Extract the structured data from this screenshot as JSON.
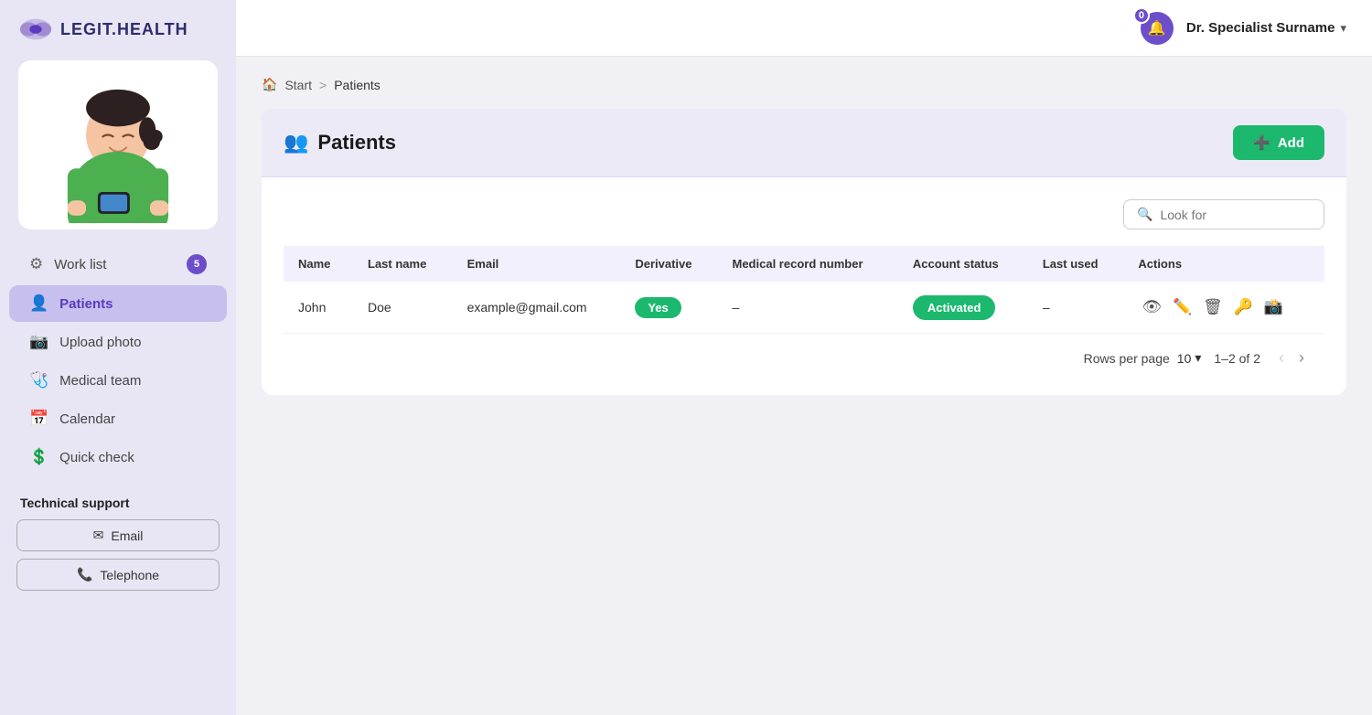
{
  "brand": {
    "name": "LEGIT.HEALTH"
  },
  "header": {
    "notification_count": "0",
    "user_name": "Dr. Specialist Surname"
  },
  "breadcrumb": {
    "home": "Start",
    "separator": ">",
    "current": "Patients"
  },
  "page": {
    "title": "Patients",
    "add_button": "Add"
  },
  "search": {
    "placeholder": "Look for"
  },
  "table": {
    "columns": [
      "Name",
      "Last name",
      "Email",
      "Derivative",
      "Medical record number",
      "Account status",
      "Last used",
      "Actions"
    ],
    "rows": [
      {
        "name": "John",
        "last_name": "Doe",
        "email": "example@gmail.com",
        "derivative": "Yes",
        "medical_record_number": "–",
        "account_status": "Activated",
        "last_used": "–"
      }
    ]
  },
  "pagination": {
    "rows_per_page_label": "Rows per page",
    "rows_per_page_value": "10",
    "info": "1–2 of 2"
  },
  "nav": {
    "items": [
      {
        "id": "work-list",
        "label": "Work list",
        "icon": "⚙",
        "badge": "5",
        "active": false
      },
      {
        "id": "patients",
        "label": "Patients",
        "icon": "👤",
        "badge": "",
        "active": true
      },
      {
        "id": "upload-photo",
        "label": "Upload photo",
        "icon": "📷",
        "badge": "",
        "active": false
      },
      {
        "id": "medical-team",
        "label": "Medical team",
        "icon": "🩺",
        "badge": "",
        "active": false
      },
      {
        "id": "calendar",
        "label": "Calendar",
        "icon": "📅",
        "badge": "",
        "active": false
      },
      {
        "id": "quick-check",
        "label": "Quick check",
        "icon": "💲",
        "badge": "",
        "active": false
      }
    ],
    "support": {
      "title": "Technical support",
      "email_label": "Email",
      "telephone_label": "Telephone"
    }
  }
}
